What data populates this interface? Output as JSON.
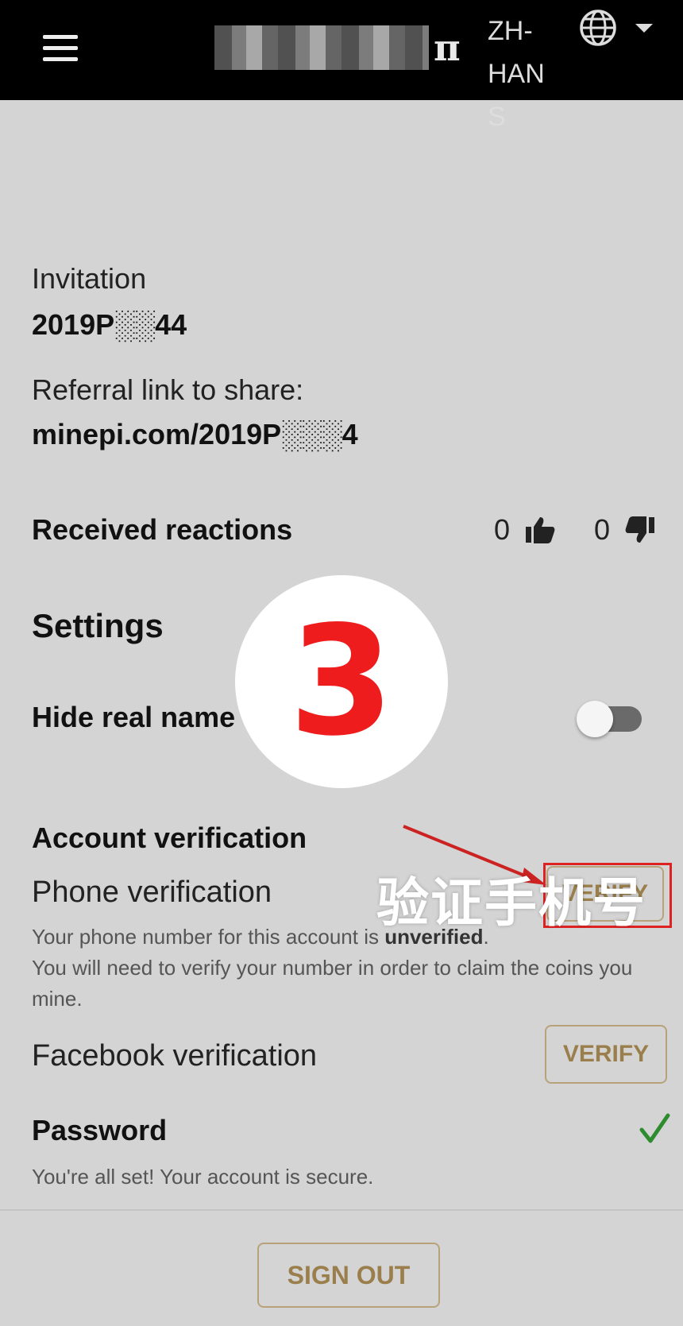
{
  "header": {
    "menu_icon": "hamburger-icon",
    "pi_symbol": "π",
    "language": "ZH-HANS",
    "globe_icon": "globe-icon",
    "caret_icon": "caret-down-icon"
  },
  "profile": {
    "invitation_label": "Invitation",
    "invitation_code": "2019P░░44",
    "referral_label": "Referral link to share:",
    "referral_link": "minepi.com/2019P░░░4"
  },
  "reactions": {
    "label": "Received reactions",
    "likes": "0",
    "dislikes": "0",
    "like_icon": "thumbs-up-icon",
    "dislike_icon": "thumbs-down-icon"
  },
  "settings": {
    "title": "Settings",
    "hide_real_name_label": "Hide real name",
    "hide_real_name_on": false
  },
  "verification": {
    "title": "Account verification",
    "phone_label": "Phone verification",
    "phone_note_prefix": "Your phone number for this account is ",
    "phone_note_status": "unverified",
    "phone_note_suffix": ".",
    "phone_note_line2": "You will need to verify your number in order to claim the coins you mine.",
    "phone_button": "VERIFY",
    "facebook_label": "Facebook verification",
    "facebook_button": "VERIFY",
    "password_label": "Password",
    "password_note": "You're all set! Your account is secure.",
    "password_icon": "checkmark-icon"
  },
  "footer": {
    "sign_out": "SIGN OUT"
  },
  "annotation": {
    "step_number": "3",
    "caption": "验证手机号",
    "accent_color": "#ee1c1c"
  }
}
